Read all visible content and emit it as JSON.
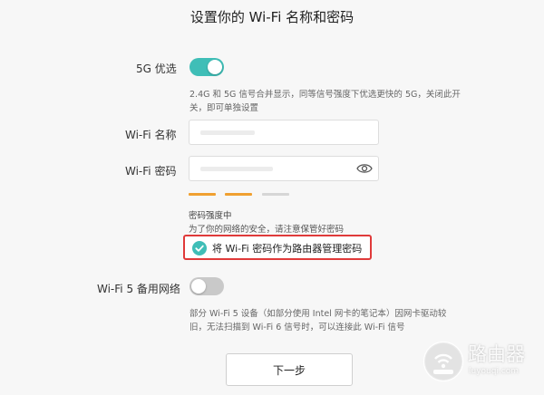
{
  "page": {
    "title": "设置你的 Wi-Fi 名称和密码"
  },
  "band5g": {
    "label": "5G 优选",
    "enabled": true,
    "desc_line1": "2.4G 和 5G 信号合并显示，同等信号强度下优选更快的 5G，关闭此开",
    "desc_line2": "关，即可单独设置"
  },
  "wifi_name": {
    "label": "Wi-Fi 名称",
    "value": ""
  },
  "wifi_password": {
    "label": "Wi-Fi 密码",
    "value": ""
  },
  "strength": {
    "label": "密码强度中",
    "level": 2,
    "max_level": 3,
    "active_color": "#f0a030",
    "inactive_color": "#d6d6d6",
    "hint": "为了你的网络的安全，请注意保管好密码"
  },
  "admin_password": {
    "checked": true,
    "label": "将 Wi-Fi 密码作为路由器管理密码",
    "highlight_color": "#e03a3a"
  },
  "wifi5_backup": {
    "label": "Wi-Fi 5 备用网络",
    "enabled": false,
    "desc_line1": "部分 Wi-Fi 5 设备（如部分使用 Intel 网卡的笔记本）因网卡驱动较",
    "desc_line2": "旧，无法扫描到 Wi-Fi 6 信号时，可以连接此 Wi-Fi 信号"
  },
  "next_button": {
    "label": "下一步"
  },
  "watermark": {
    "text": "路由器",
    "url": "luyouqi.com"
  },
  "colors": {
    "accent": "#3fbeb7",
    "toggle_off": "#c9c9c9"
  }
}
